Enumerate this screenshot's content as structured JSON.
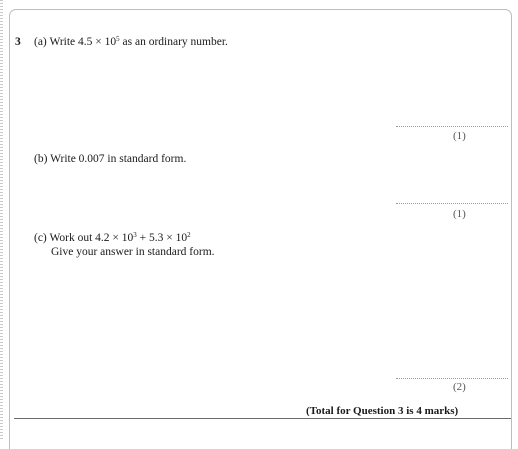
{
  "question": {
    "number": "3",
    "part_a": {
      "label": "(a)",
      "text_prefix": "Write 4.5 × 10",
      "exponent": "5",
      "text_suffix": " as an ordinary number.",
      "marks": "(1)"
    },
    "part_b": {
      "label": "(b)",
      "text": "Write 0.007 in standard form.",
      "marks": "(1)"
    },
    "part_c": {
      "label": "(c)",
      "expr_1": "Work out 4.2 × 10",
      "exp_1": "3",
      "expr_2": " + 5.3 × 10",
      "exp_2": "2",
      "line_2": "Give your answer in standard form.",
      "marks": "(2)"
    },
    "total": "(Total for Question 3 is 4 marks)"
  }
}
